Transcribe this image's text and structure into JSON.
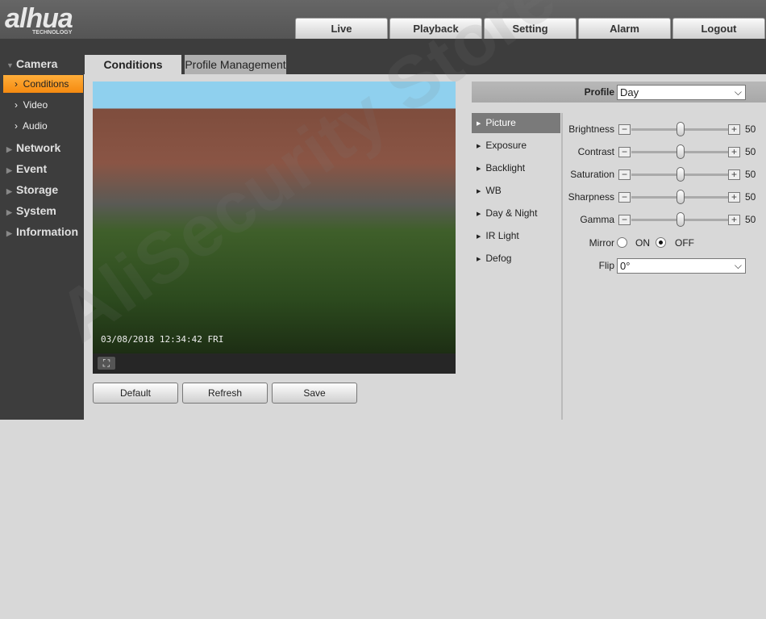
{
  "brand": {
    "logo": "alhua",
    "sub": "TECHNOLOGY"
  },
  "nav": [
    "Live",
    "Playback",
    "Setting",
    "Alarm",
    "Logout"
  ],
  "sidebar": {
    "sections": [
      {
        "label": "Camera",
        "expanded": true,
        "items": [
          "Conditions",
          "Video",
          "Audio"
        ]
      },
      {
        "label": "Network"
      },
      {
        "label": "Event"
      },
      {
        "label": "Storage"
      },
      {
        "label": "System"
      },
      {
        "label": "Information"
      }
    ],
    "active": "Conditions"
  },
  "tabs": [
    "Conditions",
    "Profile Management"
  ],
  "video": {
    "timestamp": "03/08/2018 12:34:42 FRI"
  },
  "buttons": {
    "default": "Default",
    "refresh": "Refresh",
    "save": "Save"
  },
  "profile": {
    "label": "Profile",
    "value": "Day"
  },
  "submenu": [
    "Picture",
    "Exposure",
    "Backlight",
    "WB",
    "Day & Night",
    "IR Light",
    "Defog"
  ],
  "submenu_active": "Picture",
  "sliders": [
    {
      "label": "Brightness",
      "value": "50"
    },
    {
      "label": "Contrast",
      "value": "50"
    },
    {
      "label": "Saturation",
      "value": "50"
    },
    {
      "label": "Sharpness",
      "value": "50"
    },
    {
      "label": "Gamma",
      "value": "50"
    }
  ],
  "mirror": {
    "label": "Mirror",
    "on": "ON",
    "off": "OFF",
    "selected": "OFF"
  },
  "flip": {
    "label": "Flip",
    "value": "0°"
  },
  "watermark": "AliSecurity Store",
  "colors": {
    "accent": "#f5961e",
    "header": "#5a5a5a",
    "sidebar": "#3d3d3d"
  }
}
